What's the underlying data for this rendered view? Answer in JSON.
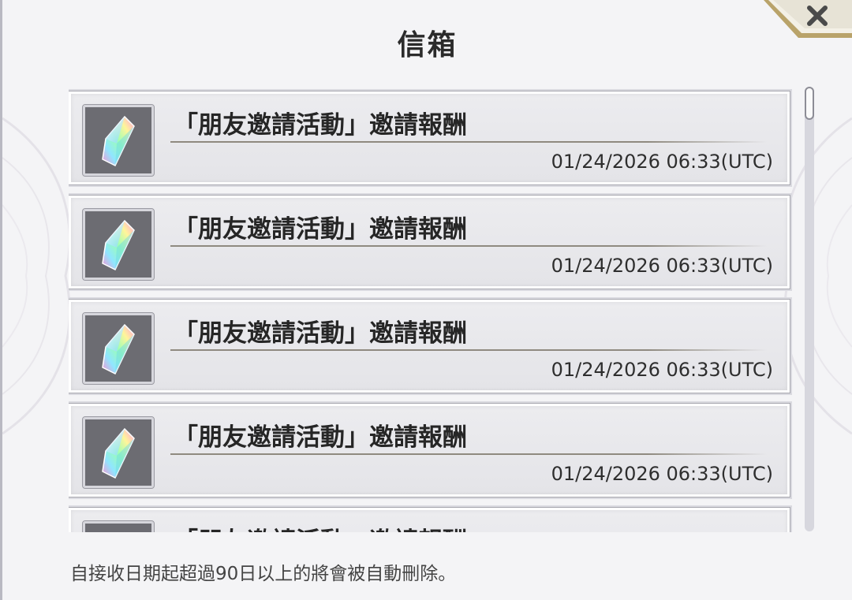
{
  "dialog": {
    "title": "信箱",
    "close_icon": "close-x-icon"
  },
  "mail_list": {
    "items": [
      {
        "title": "「朋友邀請活動」邀請報酬",
        "date": "01/24/2026 06:33(UTC)",
        "icon": "rainbow-crystal-icon"
      },
      {
        "title": "「朋友邀請活動」邀請報酬",
        "date": "01/24/2026 06:33(UTC)",
        "icon": "rainbow-crystal-icon"
      },
      {
        "title": "「朋友邀請活動」邀請報酬",
        "date": "01/24/2026 06:33(UTC)",
        "icon": "rainbow-crystal-icon"
      },
      {
        "title": "「朋友邀請活動」邀請報酬",
        "date": "01/24/2026 06:33(UTC)",
        "icon": "rainbow-crystal-icon"
      },
      {
        "title": "「朋友邀請活動」邀請報酬",
        "date": "",
        "icon": "rainbow-crystal-icon"
      }
    ]
  },
  "footer": {
    "note": "自接收日期起超過90日以上的將會被自動刪除。"
  },
  "colors": {
    "panel_bg": "#f4f4f6",
    "item_bg": "#e8e8ec",
    "accent_gold": "#b9a36a",
    "text_dark": "#262626"
  }
}
